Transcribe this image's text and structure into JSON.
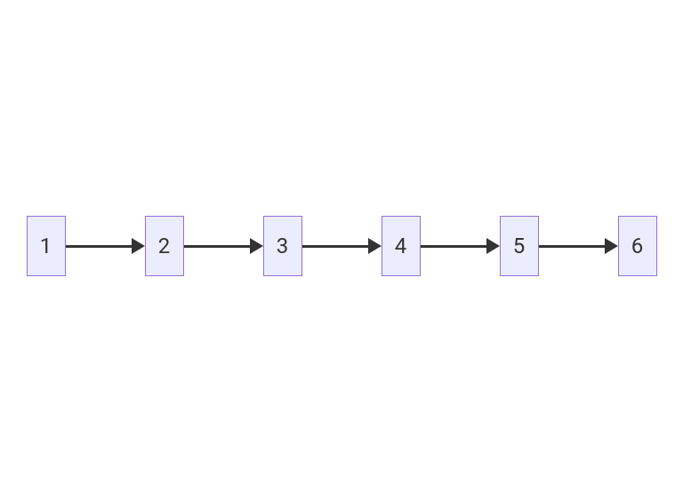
{
  "diagram": {
    "type": "flowchart-linear",
    "nodes": [
      {
        "id": "node-1",
        "label": "1"
      },
      {
        "id": "node-2",
        "label": "2"
      },
      {
        "id": "node-3",
        "label": "3"
      },
      {
        "id": "node-4",
        "label": "4"
      },
      {
        "id": "node-5",
        "label": "5"
      },
      {
        "id": "node-6",
        "label": "6"
      }
    ],
    "edges": [
      {
        "from": "node-1",
        "to": "node-2"
      },
      {
        "from": "node-2",
        "to": "node-3"
      },
      {
        "from": "node-3",
        "to": "node-4"
      },
      {
        "from": "node-4",
        "to": "node-5"
      },
      {
        "from": "node-5",
        "to": "node-6"
      }
    ],
    "colors": {
      "node_fill": "#ECECFF",
      "node_border": "#9370DB",
      "arrow": "#333333",
      "text": "#333333"
    }
  }
}
